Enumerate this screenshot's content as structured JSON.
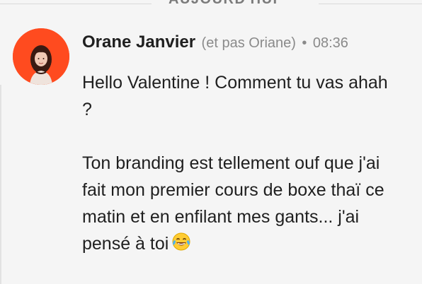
{
  "divider": {
    "label": "AUJOURD'HUI"
  },
  "message": {
    "author": "Orane Janvier",
    "nickname": "(et pas Oriane)",
    "separator": "•",
    "time": "08:36",
    "avatar_icon": "user-photo",
    "paragraph1": "Hello Valentine ! Comment tu vas ahah ?",
    "paragraph2": "Ton branding est tellement ouf que j'ai fait mon premier cours de boxe thaï ce matin et en enfilant mes gants... j'ai pensé à toi",
    "emoji": "face-with-tears-of-joy",
    "colors": {
      "background": "#f5f5f5",
      "avatar_bg": "#ff4b1f",
      "text": "#1f1f1f",
      "meta": "#8a8a8a"
    }
  }
}
